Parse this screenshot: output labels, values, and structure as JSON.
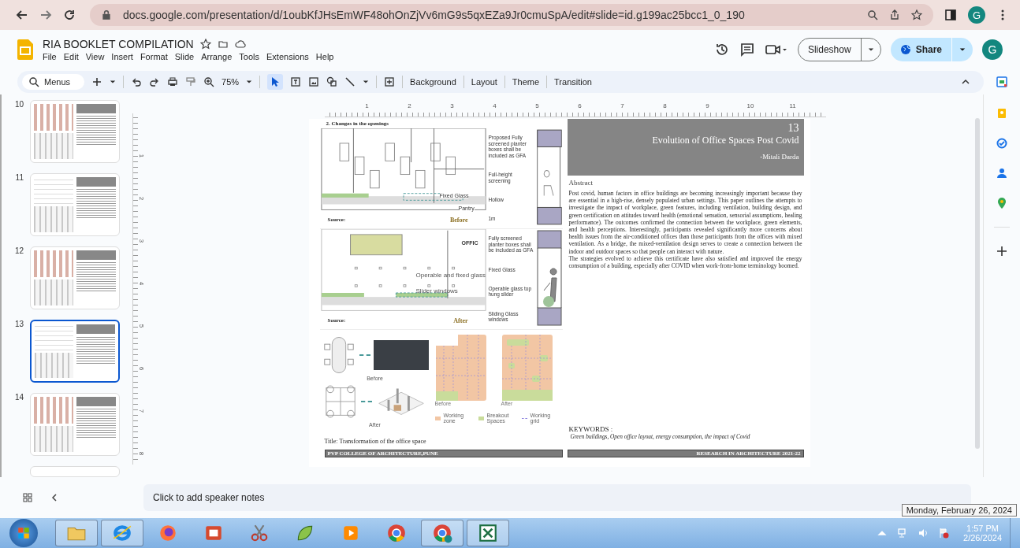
{
  "browser": {
    "url": "docs.google.com/presentation/d/1oubKfJHsEmWF48ohOnZjVv6mG9s5qxEZa9Jr0cmuSpA/edit#slide=id.g199ac25bcc1_0_190",
    "avatar": "G"
  },
  "document": {
    "title": "RIA BOOKLET COMPILATION",
    "menus": [
      "File",
      "Edit",
      "View",
      "Insert",
      "Format",
      "Slide",
      "Arrange",
      "Tools",
      "Extensions",
      "Help"
    ],
    "slideshow": "Slideshow",
    "share": "Share",
    "avatar": "G"
  },
  "toolbar": {
    "search": "Menus",
    "zoom": "75%",
    "buttons": [
      "Background",
      "Layout",
      "Theme",
      "Transition"
    ]
  },
  "filmstrip": [
    {
      "number": "10",
      "selected": false
    },
    {
      "number": "11",
      "selected": false
    },
    {
      "number": "12",
      "selected": false
    },
    {
      "number": "13",
      "selected": true
    },
    {
      "number": "14",
      "selected": false
    }
  ],
  "ruler": {
    "horizontal": [
      "1",
      "2",
      "3",
      "4",
      "5",
      "6",
      "7",
      "8",
      "9",
      "10",
      "11"
    ],
    "vertical": [
      "1",
      "2",
      "3",
      "4",
      "5",
      "6",
      "7",
      "8"
    ]
  },
  "slide": {
    "heading": "2. Changes in the openings",
    "before": {
      "plan_labels": [
        "Fixed Glass",
        "Pantry"
      ],
      "source": "Source:",
      "caption": "Before",
      "section_labels": [
        "Proposed Fully screened planter boxes shall be included as GFA",
        "Full-height screening",
        "Hollow",
        "1m"
      ]
    },
    "after": {
      "plan_labels": [
        "OFFIC",
        "Operable and fixed glass",
        "Slider windows"
      ],
      "source": "Source:",
      "caption": "After",
      "section_labels": [
        "Fully screened planter boxes shall be included as GFA",
        "Fixed Glass",
        "Operable glass top hung slider",
        "Sliding Glass windows"
      ]
    },
    "transformation": {
      "before": "Before",
      "after": "After",
      "plan_before": "Before",
      "plan_after": "After",
      "legend": [
        {
          "label": "Working zone",
          "color": "#f2c6a4",
          "kind": "swatch"
        },
        {
          "label": "Breakout Spaces",
          "color": "#c9dc9b",
          "kind": "swatch"
        },
        {
          "label": "Working grid",
          "color": "#8f86e0",
          "kind": "line"
        }
      ],
      "title": "Title: Transformation of the office space"
    },
    "footer_left": "PVP COLLEGE OF ARCHITECTURE,PUNE",
    "header": {
      "number": "13",
      "title": "Evolution of Office Spaces Post Covid",
      "author": "-Mitali Darda"
    },
    "abstract_label": "Abstract",
    "paragraphs": [
      "Post covid, human factors in office buildings are becoming increasingly important because they are essential in a high-rise, densely populated urban settings. This paper outlines the attempts to investigate the impact of workplace, green features, including ventilation, building design, and green certification on attitudes toward health (emotional sensation, sensorial assumptions, healing performance). The outcomes confirmed the connection between the workplace, green elements, and health perceptions. Interestingly, participants revealed significantly more concerns about health issues from the air-conditioned offices than those participants from the offices with mixed ventilation. As a bridge, the mixed-ventilation design serves to create a connection between the indoor and outdoor spaces so that people can interact with nature.",
      "The strategies evolved to achieve this certificate have also satisfied and improved the energy consumption of a building, especially after COVID when work-from-home terminology boomed."
    ],
    "keywords_label": "KEYWORDS :",
    "keywords": "Green buildings, Open office layout, energy consumption, the impact of Covid",
    "footer_right": "RESEARCH IN ARCHITECTURE 2021-22"
  },
  "notes": {
    "placeholder": "Click to add speaker notes"
  },
  "taskbar": {
    "apps": [
      {
        "kind": "folder",
        "open": true
      },
      {
        "kind": "ie",
        "open": true
      },
      {
        "kind": "firefox",
        "open": false
      },
      {
        "kind": "presenter",
        "open": false
      },
      {
        "kind": "scissors",
        "open": false
      },
      {
        "kind": "leaf",
        "open": false
      },
      {
        "kind": "player",
        "open": false
      },
      {
        "kind": "chrome",
        "open": false
      },
      {
        "kind": "chrome-profile",
        "open": true
      },
      {
        "kind": "excel",
        "open": true
      }
    ],
    "time": "1:57 PM",
    "date": "2/26/2024",
    "tooltip": "Monday, February 26, 2024"
  }
}
